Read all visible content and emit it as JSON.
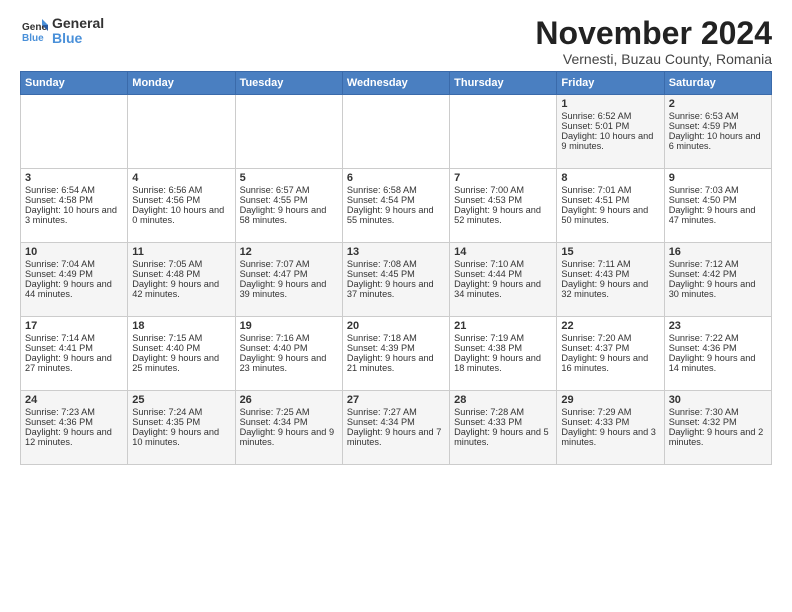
{
  "logo": {
    "general": "General",
    "blue": "Blue"
  },
  "title": "November 2024",
  "subtitle": "Vernesti, Buzau County, Romania",
  "days_of_week": [
    "Sunday",
    "Monday",
    "Tuesday",
    "Wednesday",
    "Thursday",
    "Friday",
    "Saturday"
  ],
  "weeks": [
    [
      {
        "day": "",
        "info": ""
      },
      {
        "day": "",
        "info": ""
      },
      {
        "day": "",
        "info": ""
      },
      {
        "day": "",
        "info": ""
      },
      {
        "day": "",
        "info": ""
      },
      {
        "day": "1",
        "info": "Sunrise: 6:52 AM\nSunset: 5:01 PM\nDaylight: 10 hours and 9 minutes."
      },
      {
        "day": "2",
        "info": "Sunrise: 6:53 AM\nSunset: 4:59 PM\nDaylight: 10 hours and 6 minutes."
      }
    ],
    [
      {
        "day": "3",
        "info": "Sunrise: 6:54 AM\nSunset: 4:58 PM\nDaylight: 10 hours and 3 minutes."
      },
      {
        "day": "4",
        "info": "Sunrise: 6:56 AM\nSunset: 4:56 PM\nDaylight: 10 hours and 0 minutes."
      },
      {
        "day": "5",
        "info": "Sunrise: 6:57 AM\nSunset: 4:55 PM\nDaylight: 9 hours and 58 minutes."
      },
      {
        "day": "6",
        "info": "Sunrise: 6:58 AM\nSunset: 4:54 PM\nDaylight: 9 hours and 55 minutes."
      },
      {
        "day": "7",
        "info": "Sunrise: 7:00 AM\nSunset: 4:53 PM\nDaylight: 9 hours and 52 minutes."
      },
      {
        "day": "8",
        "info": "Sunrise: 7:01 AM\nSunset: 4:51 PM\nDaylight: 9 hours and 50 minutes."
      },
      {
        "day": "9",
        "info": "Sunrise: 7:03 AM\nSunset: 4:50 PM\nDaylight: 9 hours and 47 minutes."
      }
    ],
    [
      {
        "day": "10",
        "info": "Sunrise: 7:04 AM\nSunset: 4:49 PM\nDaylight: 9 hours and 44 minutes."
      },
      {
        "day": "11",
        "info": "Sunrise: 7:05 AM\nSunset: 4:48 PM\nDaylight: 9 hours and 42 minutes."
      },
      {
        "day": "12",
        "info": "Sunrise: 7:07 AM\nSunset: 4:47 PM\nDaylight: 9 hours and 39 minutes."
      },
      {
        "day": "13",
        "info": "Sunrise: 7:08 AM\nSunset: 4:45 PM\nDaylight: 9 hours and 37 minutes."
      },
      {
        "day": "14",
        "info": "Sunrise: 7:10 AM\nSunset: 4:44 PM\nDaylight: 9 hours and 34 minutes."
      },
      {
        "day": "15",
        "info": "Sunrise: 7:11 AM\nSunset: 4:43 PM\nDaylight: 9 hours and 32 minutes."
      },
      {
        "day": "16",
        "info": "Sunrise: 7:12 AM\nSunset: 4:42 PM\nDaylight: 9 hours and 30 minutes."
      }
    ],
    [
      {
        "day": "17",
        "info": "Sunrise: 7:14 AM\nSunset: 4:41 PM\nDaylight: 9 hours and 27 minutes."
      },
      {
        "day": "18",
        "info": "Sunrise: 7:15 AM\nSunset: 4:40 PM\nDaylight: 9 hours and 25 minutes."
      },
      {
        "day": "19",
        "info": "Sunrise: 7:16 AM\nSunset: 4:40 PM\nDaylight: 9 hours and 23 minutes."
      },
      {
        "day": "20",
        "info": "Sunrise: 7:18 AM\nSunset: 4:39 PM\nDaylight: 9 hours and 21 minutes."
      },
      {
        "day": "21",
        "info": "Sunrise: 7:19 AM\nSunset: 4:38 PM\nDaylight: 9 hours and 18 minutes."
      },
      {
        "day": "22",
        "info": "Sunrise: 7:20 AM\nSunset: 4:37 PM\nDaylight: 9 hours and 16 minutes."
      },
      {
        "day": "23",
        "info": "Sunrise: 7:22 AM\nSunset: 4:36 PM\nDaylight: 9 hours and 14 minutes."
      }
    ],
    [
      {
        "day": "24",
        "info": "Sunrise: 7:23 AM\nSunset: 4:36 PM\nDaylight: 9 hours and 12 minutes."
      },
      {
        "day": "25",
        "info": "Sunrise: 7:24 AM\nSunset: 4:35 PM\nDaylight: 9 hours and 10 minutes."
      },
      {
        "day": "26",
        "info": "Sunrise: 7:25 AM\nSunset: 4:34 PM\nDaylight: 9 hours and 9 minutes."
      },
      {
        "day": "27",
        "info": "Sunrise: 7:27 AM\nSunset: 4:34 PM\nDaylight: 9 hours and 7 minutes."
      },
      {
        "day": "28",
        "info": "Sunrise: 7:28 AM\nSunset: 4:33 PM\nDaylight: 9 hours and 5 minutes."
      },
      {
        "day": "29",
        "info": "Sunrise: 7:29 AM\nSunset: 4:33 PM\nDaylight: 9 hours and 3 minutes."
      },
      {
        "day": "30",
        "info": "Sunrise: 7:30 AM\nSunset: 4:32 PM\nDaylight: 9 hours and 2 minutes."
      }
    ]
  ]
}
